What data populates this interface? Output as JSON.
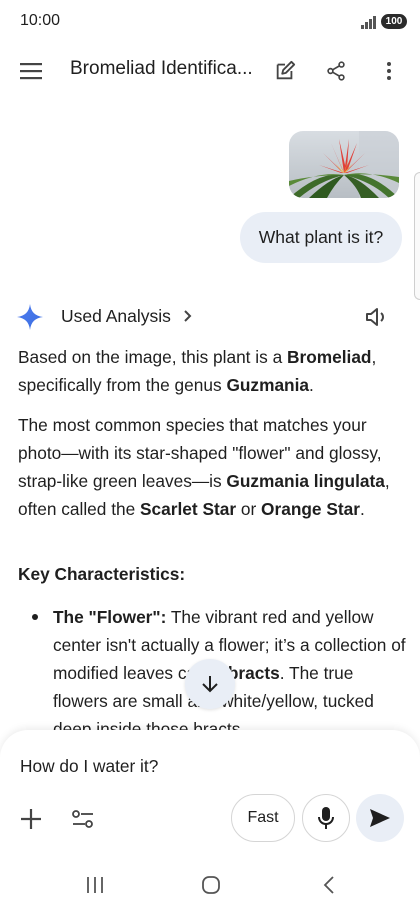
{
  "status_bar": {
    "time": "10:00",
    "battery": "100"
  },
  "app_bar": {
    "title": "Bromeliad Identifica..."
  },
  "conversation": {
    "user_message": "What plant is it?",
    "response_header": "Used Analysis",
    "paragraph1": {
      "p1": "Based on the image, this plant is a ",
      "b1": "Bromeliad",
      "p2": ", specifically from the genus ",
      "b2": "Guzmania",
      "p3": "."
    },
    "paragraph2": {
      "p1": "The most common species that matches your photo—with its star-shaped \"flower\" and glossy, strap-like green leaves—is ",
      "b1": "Guzmania lingulata",
      "p2": ", often called the ",
      "b2": "Scarlet Star",
      "p3": " or ",
      "b3": "Orange Star",
      "p4": "."
    },
    "heading": "Key Characteristics:",
    "bullet1": {
      "b1": "The \"Flower\":",
      "p1": " The vibrant red and yellow center isn't actually a flower; it’s a collection of modified leaves called ",
      "b2": "bracts",
      "p2": ". The true flowers are small and white/yellow, tucked deep inside those bracts."
    }
  },
  "composer": {
    "input_value": "How do I water it?",
    "mode_label": "Fast"
  },
  "colors": {
    "bubble": "#e9eef6",
    "gemini_blue": "#4285f4",
    "text": "#1f1f1f"
  },
  "icons": [
    "menu-icon",
    "edit-icon",
    "share-icon",
    "more-vert-icon",
    "gemini-star-icon",
    "chevron-right-icon",
    "speaker-icon",
    "arrow-down-icon",
    "plus-icon",
    "tune-icon",
    "mic-icon",
    "send-icon",
    "recents-icon",
    "home-icon",
    "back-icon"
  ]
}
